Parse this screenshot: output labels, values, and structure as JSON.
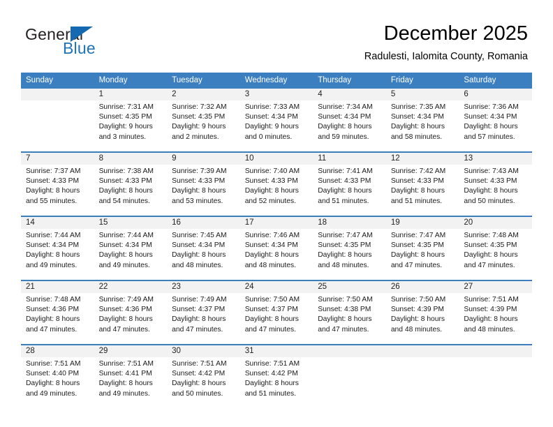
{
  "brand": {
    "name_part1": "General",
    "name_part2": "Blue",
    "logo_icon": "triangle-flag-icon"
  },
  "header": {
    "title": "December 2025",
    "subtitle": "Radulesti, Ialomita County, Romania"
  },
  "colors": {
    "header_blue": "#3c7fc1",
    "brand_blue": "#1d74bb",
    "daynum_band": "#f2f2f2",
    "text": "#1a1a1a"
  },
  "weekday_headers": [
    "Sunday",
    "Monday",
    "Tuesday",
    "Wednesday",
    "Thursday",
    "Friday",
    "Saturday"
  ],
  "weeks": [
    [
      {
        "day": "",
        "sunrise": "",
        "sunset": "",
        "daylight1": "",
        "daylight2": ""
      },
      {
        "day": "1",
        "sunrise": "Sunrise: 7:31 AM",
        "sunset": "Sunset: 4:35 PM",
        "daylight1": "Daylight: 9 hours",
        "daylight2": "and 3 minutes."
      },
      {
        "day": "2",
        "sunrise": "Sunrise: 7:32 AM",
        "sunset": "Sunset: 4:35 PM",
        "daylight1": "Daylight: 9 hours",
        "daylight2": "and 2 minutes."
      },
      {
        "day": "3",
        "sunrise": "Sunrise: 7:33 AM",
        "sunset": "Sunset: 4:34 PM",
        "daylight1": "Daylight: 9 hours",
        "daylight2": "and 0 minutes."
      },
      {
        "day": "4",
        "sunrise": "Sunrise: 7:34 AM",
        "sunset": "Sunset: 4:34 PM",
        "daylight1": "Daylight: 8 hours",
        "daylight2": "and 59 minutes."
      },
      {
        "day": "5",
        "sunrise": "Sunrise: 7:35 AM",
        "sunset": "Sunset: 4:34 PM",
        "daylight1": "Daylight: 8 hours",
        "daylight2": "and 58 minutes."
      },
      {
        "day": "6",
        "sunrise": "Sunrise: 7:36 AM",
        "sunset": "Sunset: 4:34 PM",
        "daylight1": "Daylight: 8 hours",
        "daylight2": "and 57 minutes."
      }
    ],
    [
      {
        "day": "7",
        "sunrise": "Sunrise: 7:37 AM",
        "sunset": "Sunset: 4:33 PM",
        "daylight1": "Daylight: 8 hours",
        "daylight2": "and 55 minutes."
      },
      {
        "day": "8",
        "sunrise": "Sunrise: 7:38 AM",
        "sunset": "Sunset: 4:33 PM",
        "daylight1": "Daylight: 8 hours",
        "daylight2": "and 54 minutes."
      },
      {
        "day": "9",
        "sunrise": "Sunrise: 7:39 AM",
        "sunset": "Sunset: 4:33 PM",
        "daylight1": "Daylight: 8 hours",
        "daylight2": "and 53 minutes."
      },
      {
        "day": "10",
        "sunrise": "Sunrise: 7:40 AM",
        "sunset": "Sunset: 4:33 PM",
        "daylight1": "Daylight: 8 hours",
        "daylight2": "and 52 minutes."
      },
      {
        "day": "11",
        "sunrise": "Sunrise: 7:41 AM",
        "sunset": "Sunset: 4:33 PM",
        "daylight1": "Daylight: 8 hours",
        "daylight2": "and 51 minutes."
      },
      {
        "day": "12",
        "sunrise": "Sunrise: 7:42 AM",
        "sunset": "Sunset: 4:33 PM",
        "daylight1": "Daylight: 8 hours",
        "daylight2": "and 51 minutes."
      },
      {
        "day": "13",
        "sunrise": "Sunrise: 7:43 AM",
        "sunset": "Sunset: 4:33 PM",
        "daylight1": "Daylight: 8 hours",
        "daylight2": "and 50 minutes."
      }
    ],
    [
      {
        "day": "14",
        "sunrise": "Sunrise: 7:44 AM",
        "sunset": "Sunset: 4:34 PM",
        "daylight1": "Daylight: 8 hours",
        "daylight2": "and 49 minutes."
      },
      {
        "day": "15",
        "sunrise": "Sunrise: 7:44 AM",
        "sunset": "Sunset: 4:34 PM",
        "daylight1": "Daylight: 8 hours",
        "daylight2": "and 49 minutes."
      },
      {
        "day": "16",
        "sunrise": "Sunrise: 7:45 AM",
        "sunset": "Sunset: 4:34 PM",
        "daylight1": "Daylight: 8 hours",
        "daylight2": "and 48 minutes."
      },
      {
        "day": "17",
        "sunrise": "Sunrise: 7:46 AM",
        "sunset": "Sunset: 4:34 PM",
        "daylight1": "Daylight: 8 hours",
        "daylight2": "and 48 minutes."
      },
      {
        "day": "18",
        "sunrise": "Sunrise: 7:47 AM",
        "sunset": "Sunset: 4:35 PM",
        "daylight1": "Daylight: 8 hours",
        "daylight2": "and 48 minutes."
      },
      {
        "day": "19",
        "sunrise": "Sunrise: 7:47 AM",
        "sunset": "Sunset: 4:35 PM",
        "daylight1": "Daylight: 8 hours",
        "daylight2": "and 47 minutes."
      },
      {
        "day": "20",
        "sunrise": "Sunrise: 7:48 AM",
        "sunset": "Sunset: 4:35 PM",
        "daylight1": "Daylight: 8 hours",
        "daylight2": "and 47 minutes."
      }
    ],
    [
      {
        "day": "21",
        "sunrise": "Sunrise: 7:48 AM",
        "sunset": "Sunset: 4:36 PM",
        "daylight1": "Daylight: 8 hours",
        "daylight2": "and 47 minutes."
      },
      {
        "day": "22",
        "sunrise": "Sunrise: 7:49 AM",
        "sunset": "Sunset: 4:36 PM",
        "daylight1": "Daylight: 8 hours",
        "daylight2": "and 47 minutes."
      },
      {
        "day": "23",
        "sunrise": "Sunrise: 7:49 AM",
        "sunset": "Sunset: 4:37 PM",
        "daylight1": "Daylight: 8 hours",
        "daylight2": "and 47 minutes."
      },
      {
        "day": "24",
        "sunrise": "Sunrise: 7:50 AM",
        "sunset": "Sunset: 4:37 PM",
        "daylight1": "Daylight: 8 hours",
        "daylight2": "and 47 minutes."
      },
      {
        "day": "25",
        "sunrise": "Sunrise: 7:50 AM",
        "sunset": "Sunset: 4:38 PM",
        "daylight1": "Daylight: 8 hours",
        "daylight2": "and 47 minutes."
      },
      {
        "day": "26",
        "sunrise": "Sunrise: 7:50 AM",
        "sunset": "Sunset: 4:39 PM",
        "daylight1": "Daylight: 8 hours",
        "daylight2": "and 48 minutes."
      },
      {
        "day": "27",
        "sunrise": "Sunrise: 7:51 AM",
        "sunset": "Sunset: 4:39 PM",
        "daylight1": "Daylight: 8 hours",
        "daylight2": "and 48 minutes."
      }
    ],
    [
      {
        "day": "28",
        "sunrise": "Sunrise: 7:51 AM",
        "sunset": "Sunset: 4:40 PM",
        "daylight1": "Daylight: 8 hours",
        "daylight2": "and 49 minutes."
      },
      {
        "day": "29",
        "sunrise": "Sunrise: 7:51 AM",
        "sunset": "Sunset: 4:41 PM",
        "daylight1": "Daylight: 8 hours",
        "daylight2": "and 49 minutes."
      },
      {
        "day": "30",
        "sunrise": "Sunrise: 7:51 AM",
        "sunset": "Sunset: 4:42 PM",
        "daylight1": "Daylight: 8 hours",
        "daylight2": "and 50 minutes."
      },
      {
        "day": "31",
        "sunrise": "Sunrise: 7:51 AM",
        "sunset": "Sunset: 4:42 PM",
        "daylight1": "Daylight: 8 hours",
        "daylight2": "and 51 minutes."
      },
      {
        "day": "",
        "sunrise": "",
        "sunset": "",
        "daylight1": "",
        "daylight2": ""
      },
      {
        "day": "",
        "sunrise": "",
        "sunset": "",
        "daylight1": "",
        "daylight2": ""
      },
      {
        "day": "",
        "sunrise": "",
        "sunset": "",
        "daylight1": "",
        "daylight2": ""
      }
    ]
  ]
}
